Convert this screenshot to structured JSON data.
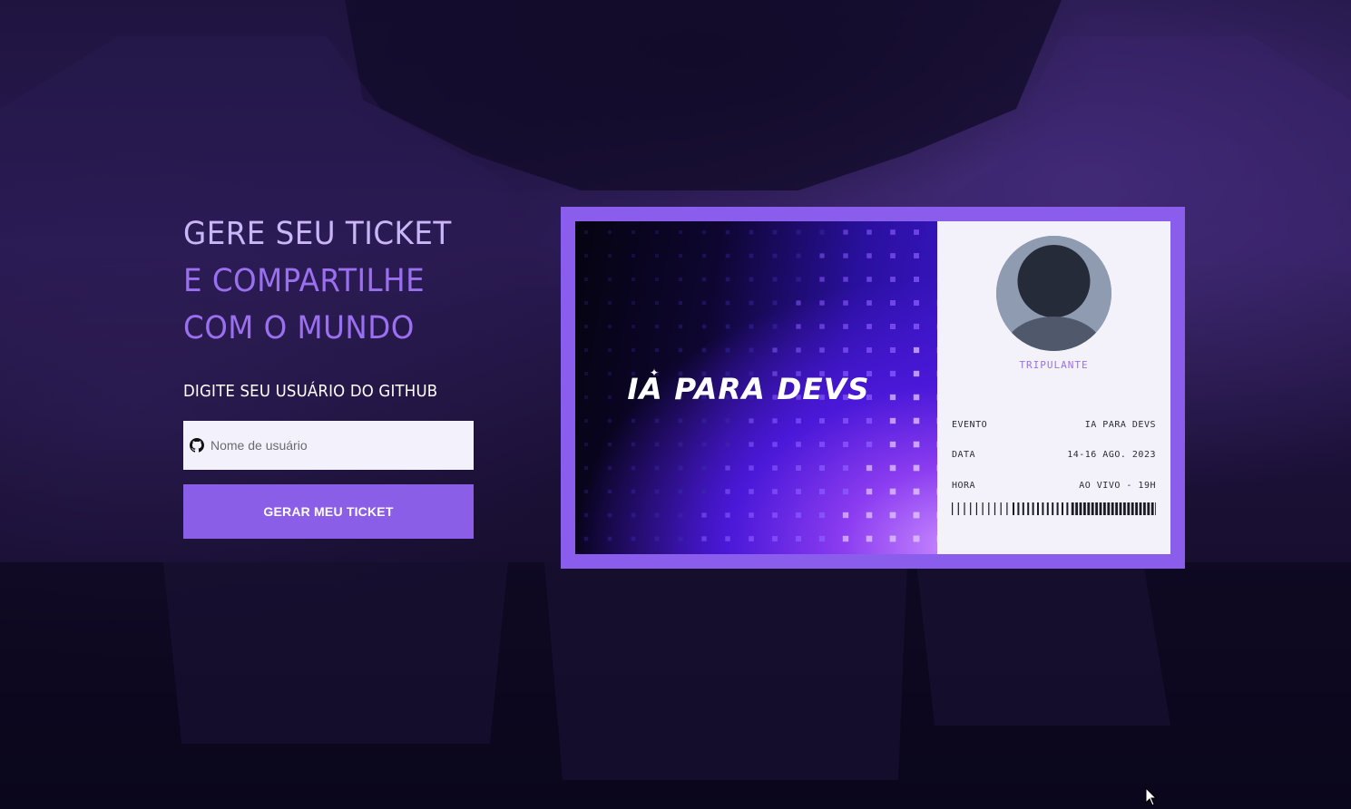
{
  "hero": {
    "line1": "GERE SEU TICKET",
    "line2": "E COMPARTILHE",
    "line3": "COM O MUNDO"
  },
  "form": {
    "prompt": "DIGITE SEU USUÁRIO DO GITHUB",
    "input_placeholder": "Nome de usuário",
    "input_value": "",
    "input_icon": "github-icon",
    "submit_label": "GERAR MEU TICKET"
  },
  "ticket": {
    "logo": "IA PARA DEVS",
    "avatar_icon": "user-placeholder-icon",
    "role": "TRIPULANTE",
    "details": [
      {
        "label": "EVENTO",
        "value": "IA PARA DEVS"
      },
      {
        "label": "DATA",
        "value": "14-16 AGO. 2023"
      },
      {
        "label": "HORA",
        "value": "AO VIVO - 19H"
      }
    ]
  },
  "colors": {
    "accent": "#8b5ee8",
    "headline_light": "#c9b6f7",
    "headline_accent": "#9a6ff0",
    "background": "#1f1440",
    "ticket_frame": "#8a5ded"
  }
}
